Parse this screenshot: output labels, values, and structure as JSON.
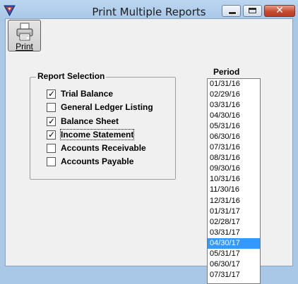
{
  "window": {
    "title": "Print Multiple Reports",
    "close_symbol": "✕"
  },
  "toolbar": {
    "print_label": "Print"
  },
  "report_selection": {
    "title": "Report Selection",
    "items": [
      {
        "label": "Trial Balance",
        "checked": true
      },
      {
        "label": "General Ledger Listing",
        "checked": false
      },
      {
        "label": "Balance Sheet",
        "checked": true
      },
      {
        "label": "Income Statement",
        "checked": true
      },
      {
        "label": "Accounts Receivable",
        "checked": false
      },
      {
        "label": "Accounts Payable",
        "checked": false
      }
    ]
  },
  "period": {
    "title": "Period",
    "items": [
      "01/31/16",
      "02/29/16",
      "03/31/16",
      "04/30/16",
      "05/31/16",
      "06/30/16",
      "07/31/16",
      "08/31/16",
      "09/30/16",
      "10/31/16",
      "11/30/16",
      "12/31/16",
      "01/31/17",
      "02/28/17",
      "03/31/17",
      "04/30/17",
      "05/31/17",
      "06/30/17",
      "07/31/17"
    ],
    "selected": "04/30/17"
  },
  "colors": {
    "selection": "#3399ff",
    "frame": "#a9c8e8",
    "close_button": "#c64b33"
  },
  "icons": {
    "app": "app-logo-icon",
    "print": "printer-icon"
  }
}
